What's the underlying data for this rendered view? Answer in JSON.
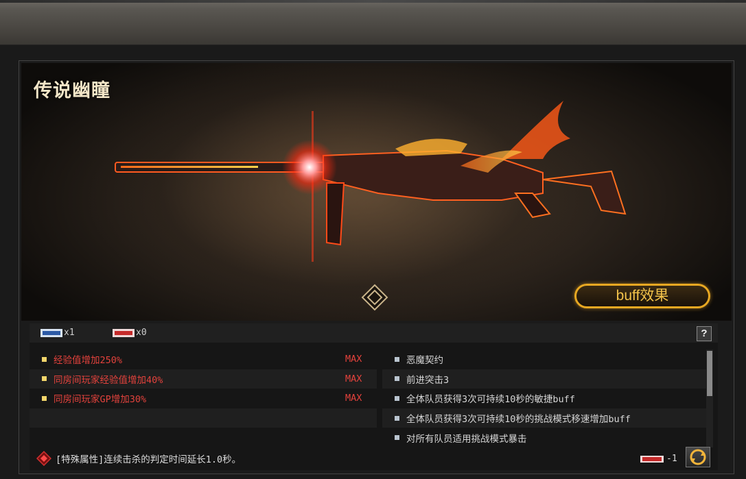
{
  "weapon": {
    "title": "传说幽瞳",
    "buff_button_label": "buff效果"
  },
  "tokens": [
    {
      "icon": "token-icon",
      "count": "x1"
    },
    {
      "icon": "token-icon-red",
      "count": "x0"
    }
  ],
  "help_label": "?",
  "attributes": [
    {
      "text": "经验值增加250%",
      "level": "MAX"
    },
    {
      "text": "同房间玩家经验值增加40%",
      "level": "MAX"
    },
    {
      "text": "同房间玩家GP增加30%",
      "level": "MAX"
    }
  ],
  "buffs": [
    "恶魔契约",
    "前进突击3",
    "全体队员获得3次可持续10秒的敏捷buff",
    "全体队员获得3次可持续10秒的挑战模式移速增加buff",
    "对所有队员适用挑战模式暴击"
  ],
  "special": "[特殊属性]连续击杀的判定时间延长1.0秒。",
  "cost": "-1",
  "colors": {
    "attribute_text": "#e3423c",
    "accent_gold": "#e8a822"
  }
}
